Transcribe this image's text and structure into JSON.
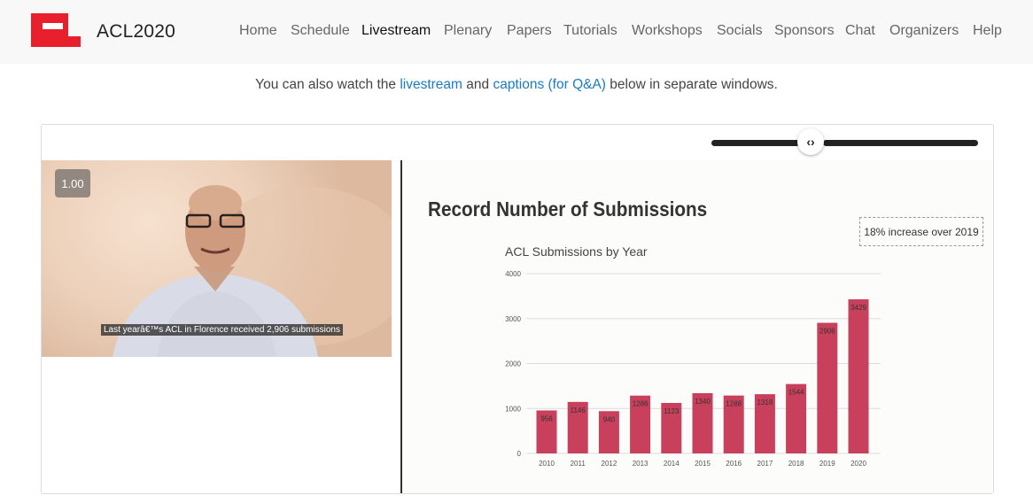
{
  "app": {
    "brand": "ACL2020",
    "nav": [
      "Home",
      "Schedule",
      "Livestream",
      "Plenary",
      "Papers",
      "Tutorials",
      "Workshops",
      "Socials",
      "Sponsors",
      "Chat",
      "Organizers",
      "Help"
    ],
    "active_nav": "Livestream"
  },
  "info": {
    "prefix": "You can also watch the",
    "link1": "livestream",
    "middle": "and",
    "link2": "captions (for Q&A)",
    "suffix": "below in separate windows."
  },
  "player": {
    "speed": "1.00",
    "caption": "Last yearâ€™s ACL in Florence received 2,906 submissions"
  },
  "slide": {
    "title": "Record Number of Submissions",
    "badge": "18% increase over 2019"
  },
  "colors": {
    "bar": "#c9405c",
    "link": "#1a7bc6",
    "logo": "#e8202c"
  },
  "icons": {
    "slider": "chevron-left-right-icon",
    "logo": "acl-logo-icon"
  },
  "chart_data": {
    "type": "bar",
    "title": "ACL Submissions by Year",
    "categories": [
      "2010",
      "2011",
      "2012",
      "2013",
      "2014",
      "2015",
      "2016",
      "2017",
      "2018",
      "2019",
      "2020"
    ],
    "values": [
      956,
      1146,
      940,
      1286,
      1123,
      1340,
      1288,
      1318,
      1544,
      2906,
      3429
    ],
    "ylim": [
      0,
      4000
    ],
    "yticks": [
      0,
      1000,
      2000,
      3000,
      4000
    ],
    "grid": true
  }
}
